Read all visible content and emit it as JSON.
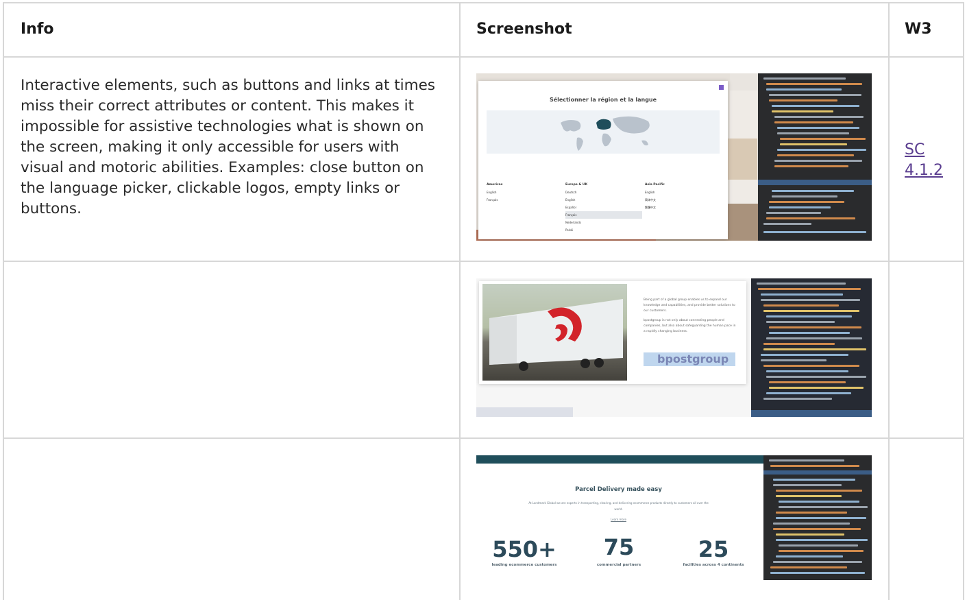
{
  "header": {
    "col1": "Info",
    "col2": "Screenshot",
    "col3": "W3"
  },
  "rows": [
    {
      "info": "Interactive elements, such as buttons and links at times miss their correct attributes or content. This makes it impossible for assistive technologies what is shown on the screen, making it only accessible for users with visual and motoric abilities. Examples: close button on the language picker, clickable logos, empty links or buttons.",
      "w3_link": "SC 4.1.2",
      "screenshot": {
        "modal_title": "Sélectionner la région et la langue",
        "columns": [
          {
            "heading": "Americas",
            "items": [
              "English",
              "Français"
            ]
          },
          {
            "heading": "Europe & UK",
            "items": [
              "Deutsch",
              "English",
              "Español",
              "Français",
              "Nederlands",
              "Polski"
            ]
          },
          {
            "heading": "Asia Pacific",
            "items": [
              "English",
              "简体中文",
              "繁體中文"
            ]
          }
        ]
      }
    },
    {
      "info": "",
      "w3_link": "",
      "screenshot": {
        "paragraph_1": "Being part of a global group enables us to expand our knowledge and capabilities, and provide better solutions to our customers.",
        "paragraph_2": "bpostgroup is not only about connecting people and companies, but also about safeguarding the human pace in a rapidly changing business.",
        "logo": "bpostgroup"
      }
    },
    {
      "info": "",
      "w3_link": "",
      "screenshot": {
        "title": "Parcel Delivery made easy",
        "subtitle": "At Landmark Global we are experts in transporting, clearing, and delivering ecommerce products directly to customers all over the world.",
        "learn_more": "Learn more",
        "stats": [
          {
            "value": "550+",
            "label": "leading ecommerce customers"
          },
          {
            "value": "75",
            "label": "commercial partners"
          },
          {
            "value": "25",
            "label": "facilities across 4 continents"
          }
        ]
      }
    }
  ],
  "colors": {
    "border": "#d7d7d7",
    "link": "#5a3d8f",
    "code_bg": "#2a2b2d"
  }
}
